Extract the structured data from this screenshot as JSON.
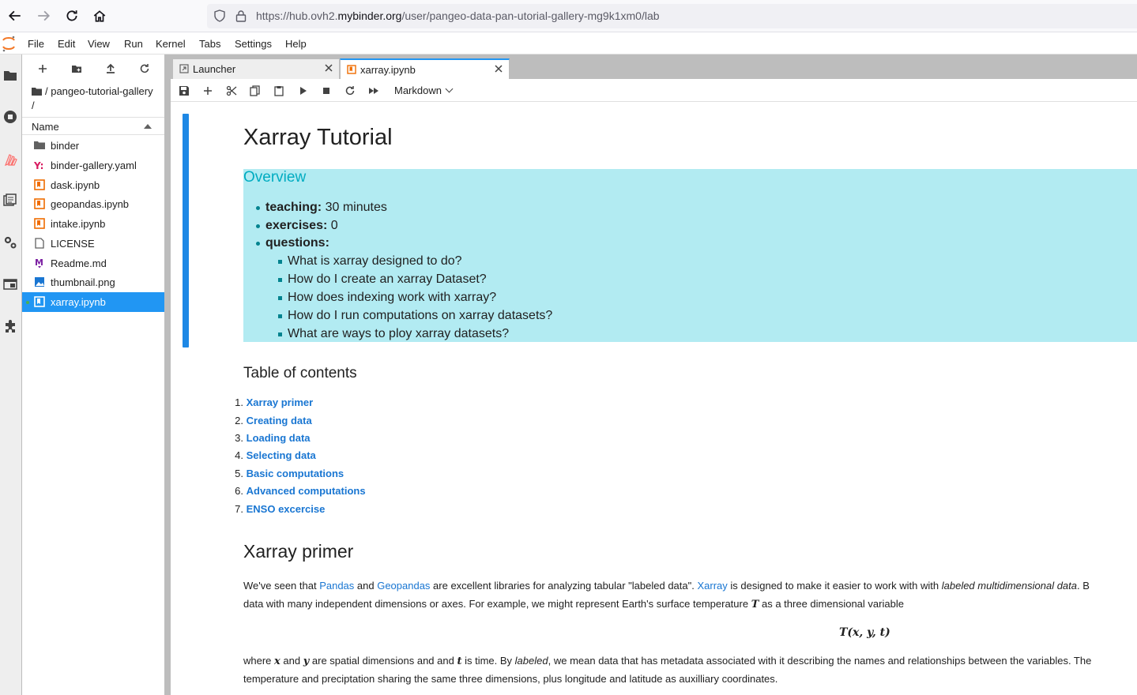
{
  "browser": {
    "url_prefix": "https://hub.ovh2.",
    "url_domain": "mybinder.org",
    "url_path": "/user/pangeo-data-pan-utorial-gallery-mg9k1xm0/lab"
  },
  "menu": [
    "File",
    "Edit",
    "View",
    "Run",
    "Kernel",
    "Tabs",
    "Settings",
    "Help"
  ],
  "filebrowser": {
    "breadcrumb": "/ pangeo-tutorial-gallery /",
    "column_header": "Name",
    "files": [
      {
        "name": "binder",
        "icon": "folder-icon"
      },
      {
        "name": "binder-gallery.yaml",
        "icon": "yaml-icon"
      },
      {
        "name": "dask.ipynb",
        "icon": "notebook-icon"
      },
      {
        "name": "geopandas.ipynb",
        "icon": "notebook-icon"
      },
      {
        "name": "intake.ipynb",
        "icon": "notebook-icon"
      },
      {
        "name": "LICENSE",
        "icon": "file-icon"
      },
      {
        "name": "Readme.md",
        "icon": "markdown-icon"
      },
      {
        "name": "thumbnail.png",
        "icon": "image-icon"
      },
      {
        "name": "xarray.ipynb",
        "icon": "notebook-icon",
        "selected": true
      }
    ]
  },
  "tabs": [
    {
      "label": "Launcher",
      "active": false
    },
    {
      "label": "xarray.ipynb",
      "active": true
    }
  ],
  "notebook_toolbar": {
    "cell_type": "Markdown"
  },
  "notebook": {
    "title": "Xarray Tutorial",
    "overview": {
      "heading": "Overview",
      "teaching_label": "teaching:",
      "teaching_value": " 30 minutes",
      "exercises_label": "exercises:",
      "exercises_value": " 0",
      "questions_label": "questions:",
      "questions": [
        "What is xarray designed to do?",
        "How do I create an xarray Dataset?",
        "How does indexing work with xarray?",
        "How do I run computations on xarray datasets?",
        "What are ways to ploy xarray datasets?"
      ]
    },
    "toc_heading": "Table of contents",
    "toc": [
      "Xarray primer",
      "Creating data",
      "Loading data",
      "Selecting data",
      "Basic computations",
      "Advanced computations",
      "ENSO excercise"
    ],
    "primer_heading": "Xarray primer",
    "para1": {
      "t1": "We've seen that ",
      "link1": "Pandas",
      "t2": " and ",
      "link2": "Geopandas",
      "t3": " are excellent libraries for analyzing tabular \"labeled data\". ",
      "link3": "Xarray",
      "t4": " is designed to make it easier to work with with ",
      "em": "labeled multidimensional data",
      "t5": ". B"
    },
    "para2": {
      "t1": "data with many independent dimensions or axes. For example, we might represent Earth's surface temperature ",
      "math": "T",
      "t2": " as a three dimensional variable"
    },
    "display_math": "T(x, y, t)",
    "para3": {
      "t1": "where ",
      "m1": "x",
      "t2": " and ",
      "m2": "y",
      "t3": " are spatial dimensions and and ",
      "m3": "t",
      "t4": " is time. By ",
      "em": "labeled",
      "t5": ", we mean data that has metadata associated with it describing the names and relationships between the variables. The"
    },
    "para4": "temperature and preciptation sharing the same three dimensions, plus longitude and latitude as auxilliary coordinates."
  },
  "colors": {
    "accent": "#2196f3",
    "overview_bg": "#b2ebf2",
    "overview_text": "#00838f",
    "link": "#1976d2"
  }
}
